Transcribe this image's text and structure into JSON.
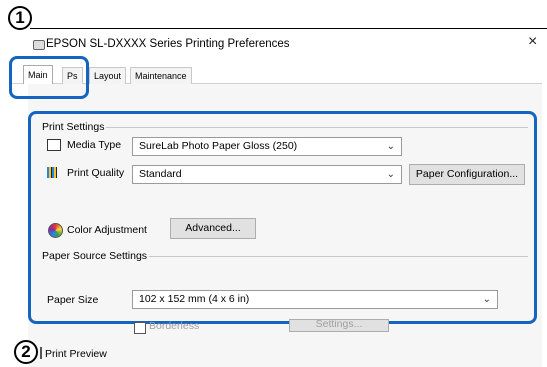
{
  "window": {
    "title": "EPSON SL-DXXXX Series Printing Preferences",
    "close_symbol": "×"
  },
  "callouts": {
    "one": "1",
    "two": "2"
  },
  "tabs": [
    {
      "label": "Main",
      "active": true
    },
    {
      "label": "Ps",
      "active": false
    },
    {
      "label": "Layout",
      "active": false
    },
    {
      "label": "Maintenance",
      "active": false
    }
  ],
  "print_settings": {
    "group_label": "Print Settings",
    "media_type": {
      "label": "Media Type",
      "value": "SureLab Photo Paper Gloss (250)"
    },
    "print_quality": {
      "label": "Print Quality",
      "value": "Standard"
    },
    "paper_config_button": "Paper Configuration...",
    "color_adjustment": {
      "label": "Color Adjustment",
      "button": "Advanced..."
    }
  },
  "paper_source": {
    "group_label": "Paper Source Settings",
    "paper_size": {
      "label": "Paper Size",
      "value": "102 x 152 mm (4 x 6 in)"
    }
  },
  "borderless": {
    "label": "Borderless",
    "settings_button": "Settings..."
  },
  "print_preview": {
    "label": "Print Preview"
  },
  "colors": {
    "highlight": "#1565c0",
    "panel": "#f6f6f6"
  }
}
